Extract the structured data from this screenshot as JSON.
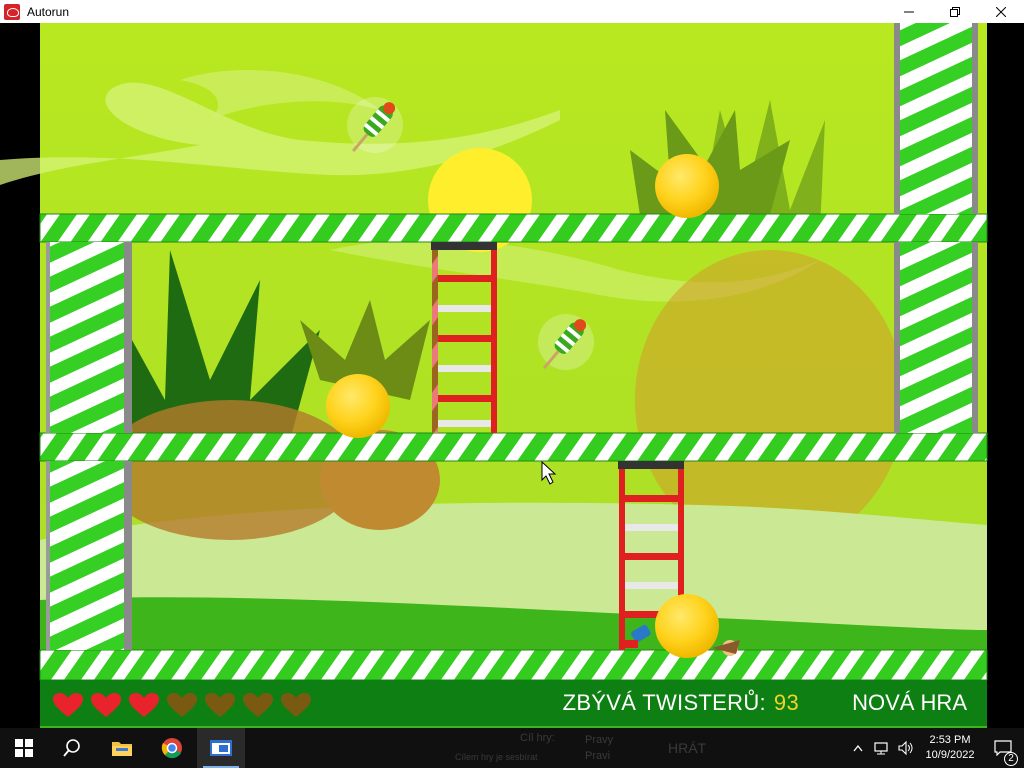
{
  "window": {
    "title": "Autorun",
    "app_icon": "red-app-icon"
  },
  "hud": {
    "lives_total": 7,
    "lives_remaining": 3,
    "remaining_label": "ZBÝVÁ TWISTERŮ:",
    "remaining_count": "93",
    "new_game_label": "NOVÁ HRA"
  },
  "taskbar": {
    "time": "2:53 PM",
    "date": "10/9/2022",
    "notification_count": "2",
    "ghost_texts": {
      "goal": "Cíl hry:",
      "rules": "Pravy",
      "play": "HRÁT",
      "goal_sub": "Cílem hry je sesbírat",
      "rules_sub": "Pravi"
    }
  },
  "colors": {
    "stripe_green": "#33cc1f",
    "ball_yellow": "#ffd21c",
    "hud_green": "#0e7f12",
    "heart_full": "#e8232c",
    "heart_empty": "#7a5a10"
  }
}
